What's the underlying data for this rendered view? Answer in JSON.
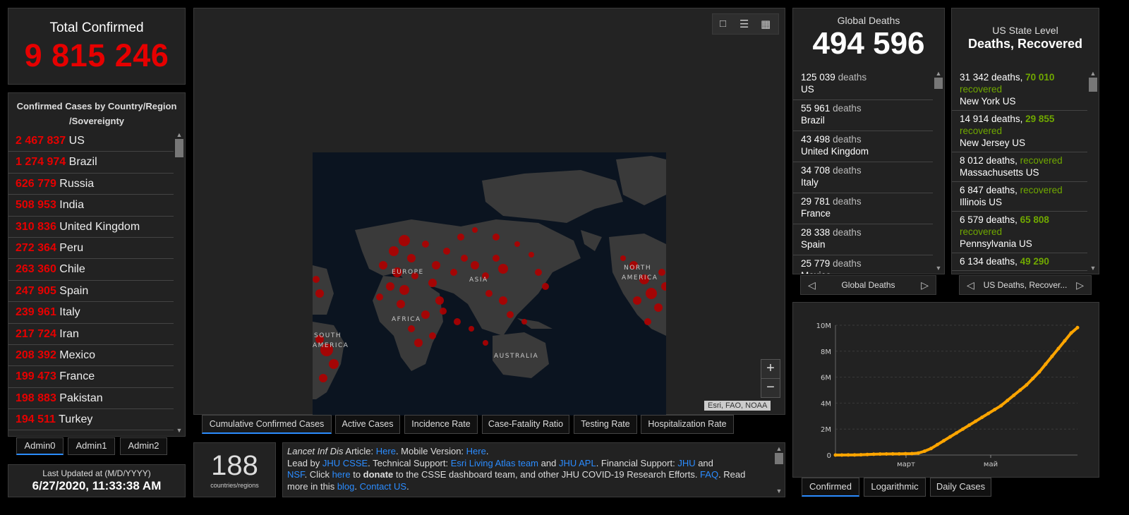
{
  "total": {
    "label": "Total Confirmed",
    "value": "9 815 246"
  },
  "countries": {
    "header": "Confirmed Cases by Country/Region /Sovereignty",
    "items": [
      {
        "value": "2 467 837",
        "name": "US"
      },
      {
        "value": "1 274 974",
        "name": "Brazil"
      },
      {
        "value": "626 779",
        "name": "Russia"
      },
      {
        "value": "508 953",
        "name": "India"
      },
      {
        "value": "310 836",
        "name": "United Kingdom"
      },
      {
        "value": "272 364",
        "name": "Peru"
      },
      {
        "value": "263 360",
        "name": "Chile"
      },
      {
        "value": "247 905",
        "name": "Spain"
      },
      {
        "value": "239 961",
        "name": "Italy"
      },
      {
        "value": "217 724",
        "name": "Iran"
      },
      {
        "value": "208 392",
        "name": "Mexico"
      },
      {
        "value": "199 473",
        "name": "France"
      },
      {
        "value": "198 883",
        "name": "Pakistan"
      },
      {
        "value": "194 511",
        "name": "Turkey"
      }
    ]
  },
  "admin_tabs": [
    "Admin0",
    "Admin1",
    "Admin2"
  ],
  "updated": {
    "label": "Last Updated at (M/D/YYYY)",
    "value": "6/27/2020, 11:33:38 AM"
  },
  "map": {
    "labels": [
      "EUROPE",
      "ASIA",
      "NORTH",
      "AMERICA",
      "AFRICA",
      "SOUTH",
      "AMERICA",
      "AUSTRALIA"
    ],
    "attribution": "Esri, FAO, NOAA",
    "zoom_in": "+",
    "zoom_out": "−",
    "tabs": [
      "Cumulative Confirmed Cases",
      "Active Cases",
      "Incidence Rate",
      "Case-Fatality Ratio",
      "Testing Rate",
      "Hospitalization Rate"
    ]
  },
  "count": {
    "value": "188",
    "label": "countries/regions"
  },
  "info": {
    "p1a": "Lancet Inf Dis",
    "p1b": " Article: ",
    "p1c": "Here",
    "p1d": ". Mobile Version: ",
    "p1e": "Here",
    "p1f": ".",
    "p2a": "Lead by ",
    "p2b": "JHU CSSE",
    "p2c": ". Technical Support: ",
    "p2d": "Esri Living Atlas team",
    "p2e": " and ",
    "p2f": "JHU APL",
    "p2g": ". Financial Support: ",
    "p2h": "JHU",
    "p2i": " and ",
    "p3a": "NSF",
    "p3b": ". Click ",
    "p3c": "here",
    "p3d": " to ",
    "p3e": "donate",
    "p3f": " to the CSSE dashboard team, and other JHU COVID-19 Research Efforts. ",
    "p3g": "FAQ",
    "p3h": ". Read",
    "p4a": "more in this ",
    "p4b": "blog",
    "p4c": ". ",
    "p4d": "Contact US",
    "p4e": "."
  },
  "global_deaths": {
    "label": "Global Deaths",
    "value": "494 596",
    "unit": "deaths",
    "items": [
      {
        "value": "125 039",
        "name": "US"
      },
      {
        "value": "55 961",
        "name": "Brazil"
      },
      {
        "value": "43 498",
        "name": "United Kingdom"
      },
      {
        "value": "34 708",
        "name": "Italy"
      },
      {
        "value": "29 781",
        "name": "France"
      },
      {
        "value": "28 338",
        "name": "Spain"
      },
      {
        "value": "25 779",
        "name": "Mexico"
      }
    ],
    "pager": "Global Deaths"
  },
  "us_states": {
    "label1": "US State Level",
    "label2": "Deaths, Recovered",
    "recovered_word": "recovered",
    "items": [
      {
        "deaths": "31 342 deaths, ",
        "recovered": "70 010",
        "name": "New York US"
      },
      {
        "deaths": "14 914 deaths, ",
        "recovered": "29 855",
        "name": "New Jersey US"
      },
      {
        "deaths": "8 012 deaths, ",
        "recovered": "",
        "name": "Massachusetts US"
      },
      {
        "deaths": "6 847 deaths, ",
        "recovered": "",
        "name": "Illinois US"
      },
      {
        "deaths": "6 579 deaths, ",
        "recovered": "65 808",
        "name": "Pennsylvania US"
      },
      {
        "deaths": "6 134 deaths, ",
        "recovered": "49 290",
        "name": ""
      }
    ],
    "pager": "US Deaths, Recover..."
  },
  "chart_data": {
    "type": "line",
    "yticks": [
      "10M",
      "8M",
      "6M",
      "4M",
      "2M",
      "0"
    ],
    "xticks": [
      "март",
      "май"
    ],
    "ylim": [
      0,
      10000000
    ],
    "series": [
      {
        "values": [
          0,
          2000,
          5000,
          10000,
          20000,
          40000,
          60000,
          75000,
          80000,
          85000,
          90000,
          100000,
          110000,
          150000,
          300000,
          500000,
          800000,
          1100000,
          1400000,
          1700000,
          2000000,
          2300000,
          2600000,
          2900000,
          3200000,
          3500000,
          3800000,
          4200000,
          4600000,
          5000000,
          5400000,
          5900000,
          6400000,
          7000000,
          7600000,
          8200000,
          8800000,
          9400000,
          9815246
        ]
      }
    ],
    "color": "#ffa500"
  },
  "chart_tabs": [
    "Confirmed",
    "Logarithmic",
    "Daily Cases"
  ]
}
